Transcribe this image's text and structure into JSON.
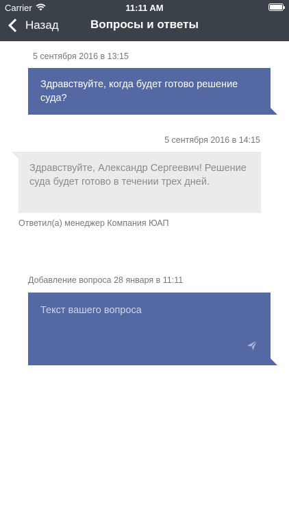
{
  "status_bar": {
    "carrier": "Carrier",
    "time": "11:11 AM"
  },
  "nav": {
    "back_label": "Назад",
    "title": "Вопросы и ответы"
  },
  "messages": [
    {
      "timestamp": "5 сентября 2016 в 13:15",
      "text": "Здравствуйте, когда будет готово решение суда?"
    },
    {
      "timestamp": "5 сентября 2016 в 14:15",
      "text": "Здравствуйте, Александр Сергеевич! Решение суда будет готово в течении трех дней.",
      "caption": "Ответил(а) менеджер Компания ЮАП"
    }
  ],
  "compose": {
    "header": "Добавление вопроса 28 января в 11:11",
    "placeholder": "Текст вашего вопроса"
  },
  "colors": {
    "header_bg": "#3a4149",
    "outgoing_bubble": "#5468a3",
    "incoming_bubble": "#ebebeb"
  },
  "icons": {
    "back": "chevron-left-icon",
    "wifi": "wifi-icon",
    "battery": "battery-icon",
    "send": "send-icon"
  }
}
